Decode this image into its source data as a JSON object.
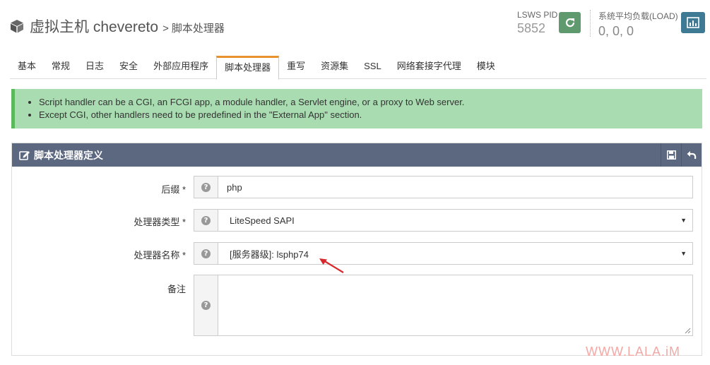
{
  "header": {
    "title": "虚拟主机 chevereto",
    "separator": ">",
    "subtitle": "脚本处理器",
    "pid_label": "LSWS PID",
    "pid_value": "5852",
    "load_label": "系统平均负载(LOAD)",
    "load_value": "0, 0, 0",
    "reload_icon": "refresh-icon",
    "stats_icon": "bar-chart-icon",
    "reload_color": "#5f9a6f",
    "stats_color": "#3f7a95"
  },
  "tabs": [
    {
      "label": "基本"
    },
    {
      "label": "常规"
    },
    {
      "label": "日志"
    },
    {
      "label": "安全"
    },
    {
      "label": "外部应用程序"
    },
    {
      "label": "脚本处理器",
      "active": true
    },
    {
      "label": "重写"
    },
    {
      "label": "资源集"
    },
    {
      "label": "SSL"
    },
    {
      "label": "网络套接字代理"
    },
    {
      "label": "模块"
    }
  ],
  "alert": {
    "items": [
      "Script handler can be a CGI, an FCGI app, a module handler, a Servlet engine, or a proxy to Web server.",
      "Except CGI, other handlers need to be predefined in the \"External App\" section."
    ],
    "color": "#a9dcb1"
  },
  "panel": {
    "title": "脚本处理器定义",
    "header_color": "#5c6780",
    "save_icon": "save-icon",
    "back_icon": "undo-icon",
    "fields": {
      "suffix": {
        "label": "后缀 *",
        "value": "php"
      },
      "handler_type": {
        "label": "处理器类型 *",
        "value": "LiteSpeed SAPI"
      },
      "handler_name": {
        "label": "处理器名称 *",
        "value": "[服务器级]: lsphp74"
      },
      "notes": {
        "label": "备注",
        "value": ""
      }
    }
  },
  "watermark": "WWW.LALA.iM"
}
